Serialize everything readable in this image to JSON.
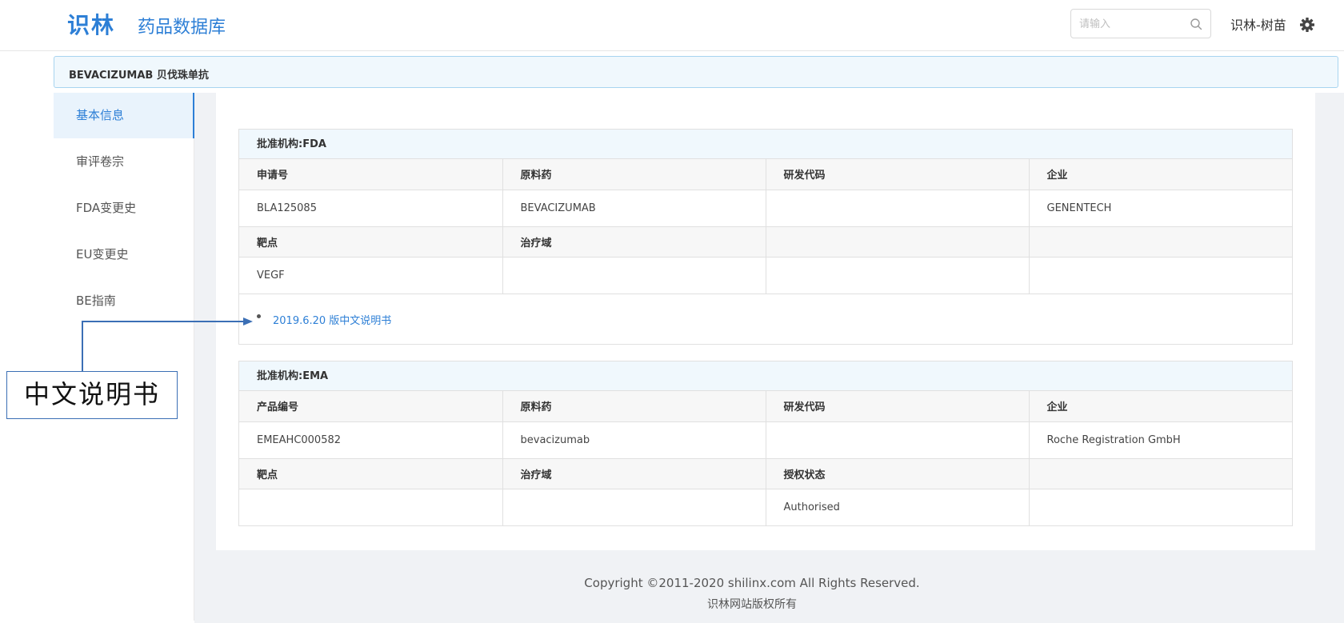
{
  "header": {
    "logo": "识林",
    "title": "药品数据库",
    "search_placeholder": "请输入",
    "user": "识林-树苗"
  },
  "drug": {
    "name": "BEVACIZUMAB 贝伐珠单抗"
  },
  "sidebar": {
    "items": [
      {
        "label": "基本信息",
        "active": true
      },
      {
        "label": "审评卷宗",
        "active": false
      },
      {
        "label": "FDA变更史",
        "active": false
      },
      {
        "label": "EU变更史",
        "active": false
      },
      {
        "label": "BE指南",
        "active": false
      }
    ]
  },
  "fda": {
    "heading": "批准机构:FDA",
    "header_row1": [
      "申请号",
      "原料药",
      "研发代码",
      "企业"
    ],
    "row1": [
      "BLA125085",
      "BEVACIZUMAB",
      "",
      "GENENTECH"
    ],
    "header_row2": [
      "靶点",
      "治疗域",
      "",
      ""
    ],
    "row2": [
      "VEGF",
      "",
      "",
      ""
    ],
    "link": "2019.6.20 版中文说明书"
  },
  "ema": {
    "heading": "批准机构:EMA",
    "header_row1": [
      "产品编号",
      "原料药",
      "研发代码",
      "企业"
    ],
    "row1": [
      "EMEAHC000582",
      "bevacizumab",
      "",
      "Roche Registration GmbH"
    ],
    "header_row2": [
      "靶点",
      "治疗域",
      "授权状态",
      ""
    ],
    "row2": [
      "",
      "",
      "Authorised",
      ""
    ]
  },
  "footer": {
    "copyright": "Copyright ©2011-2020 shilinx.com All Rights Reserved.",
    "rights_cn": "识林网站版权所有"
  },
  "annotation": {
    "label": "中文说明书"
  },
  "colors": {
    "accent": "#2d7fd6",
    "header_band": "#f0f8fd",
    "page_bg": "#f0f2f5"
  }
}
